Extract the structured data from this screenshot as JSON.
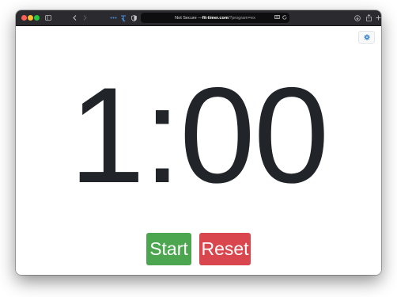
{
  "browser": {
    "url_prefix": "Not Secure — ",
    "url_domain": "fit-timer.com",
    "url_path": "/?program=ex",
    "icons": [
      "sidebar-icon",
      "back-icon",
      "forward-icon",
      "extensions-icon",
      "shield-icon",
      "reader-icon",
      "reload-icon",
      "download-icon",
      "share-icon",
      "new-tab-icon",
      "tabs-overview-icon"
    ]
  },
  "timer": {
    "display": "1:00"
  },
  "controls": {
    "start_label": "Start",
    "reset_label": "Reset",
    "settings_icon": "gear-icon"
  },
  "colors": {
    "start": "#4ca64f",
    "reset": "#d9464e",
    "timer_text": "#212529",
    "settings_icon": "#3b82d6"
  }
}
